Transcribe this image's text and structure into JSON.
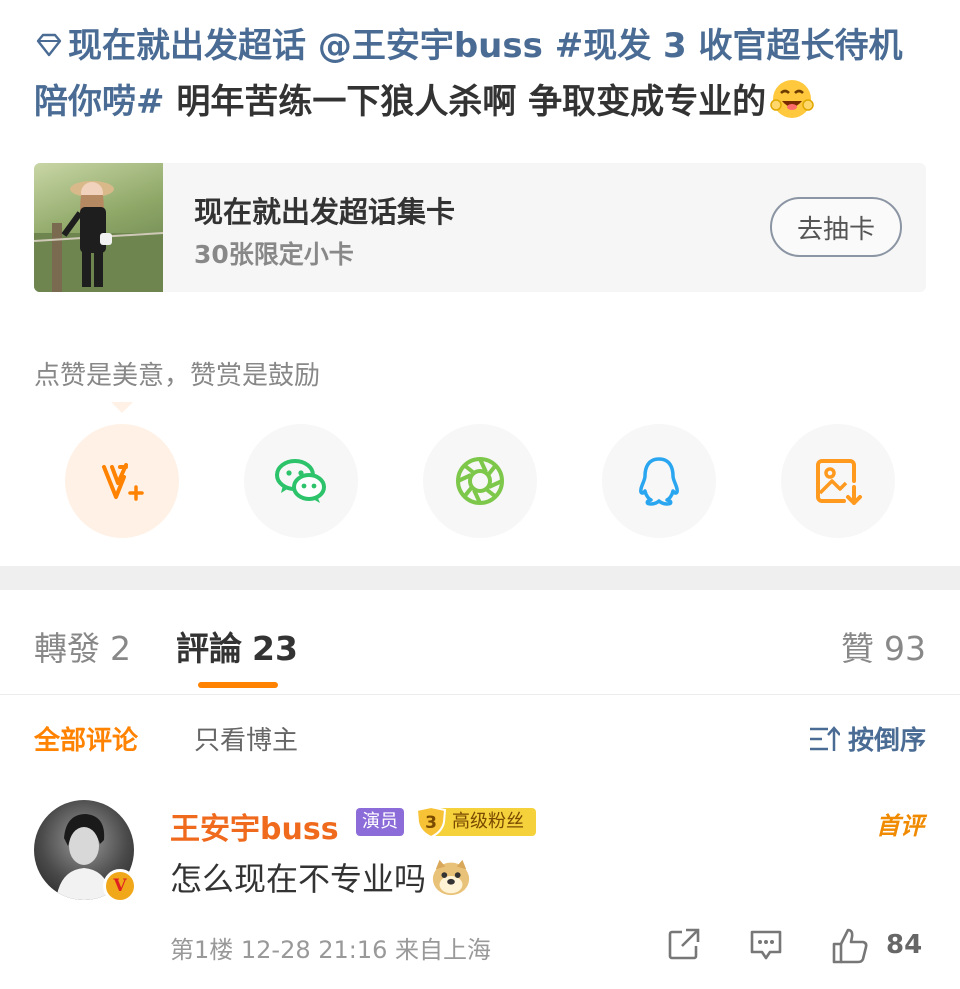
{
  "post": {
    "topic_link": "现在就出发超话",
    "mention": "@王安宇buss",
    "hashtag": "#现发 3 收官超长待机陪你唠#",
    "body": " 明年苦练一下狼人杀啊 争取变成专业的"
  },
  "card": {
    "title": "现在就出发超话集卡",
    "subtitle": "30张限定小卡",
    "button": "去抽卡"
  },
  "reward_hint": "点赞是美意，赞赏是鼓励",
  "share_buttons": [
    "reward-icon",
    "wechat-icon",
    "moments-icon",
    "qq-icon",
    "save-image-icon"
  ],
  "tabs": {
    "repost": {
      "label": "轉發",
      "count": "2"
    },
    "comment": {
      "label": "評論",
      "count": "23"
    },
    "like": {
      "label": "贊",
      "count": "93"
    }
  },
  "filters": {
    "all": "全部评论",
    "author_only": "只看博主",
    "sort": "按倒序"
  },
  "comment": {
    "username": "王安宇buss",
    "role_tag": "演员",
    "fan_level": "3",
    "fan_tag": "高级粉丝",
    "badge": "首评",
    "text": "怎么现在不专业吗",
    "meta": "第1楼  12-28 21:16  来自上海",
    "likes": "84"
  },
  "colors": {
    "link": "#4a6c94",
    "accent": "#ff8200",
    "username": "#f06a1e"
  }
}
